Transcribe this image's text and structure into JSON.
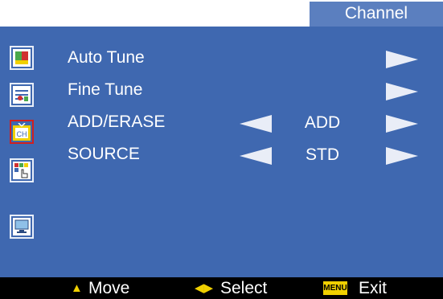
{
  "header": {
    "title": "Channel"
  },
  "sidebar": {
    "items": [
      {
        "icon": "picture-icon"
      },
      {
        "icon": "settings-icon"
      },
      {
        "icon": "channel-icon",
        "label": "CH",
        "active": true
      },
      {
        "icon": "features-icon"
      },
      {
        "icon": "display-icon"
      }
    ]
  },
  "menu": {
    "rows": [
      {
        "label": "Auto Tune",
        "value": ""
      },
      {
        "label": "Fine Tune",
        "value": ""
      },
      {
        "label": "ADD/ERASE",
        "value": "ADD"
      },
      {
        "label": "SOURCE",
        "value": "STD"
      }
    ]
  },
  "footer": {
    "move_label": "Move",
    "select_label": "Select",
    "menu_key": "MENU",
    "exit_label": "Exit"
  },
  "colors": {
    "panel": "#3f68b0",
    "title_bar": "#5b7fbf",
    "accent": "#f0d000"
  }
}
